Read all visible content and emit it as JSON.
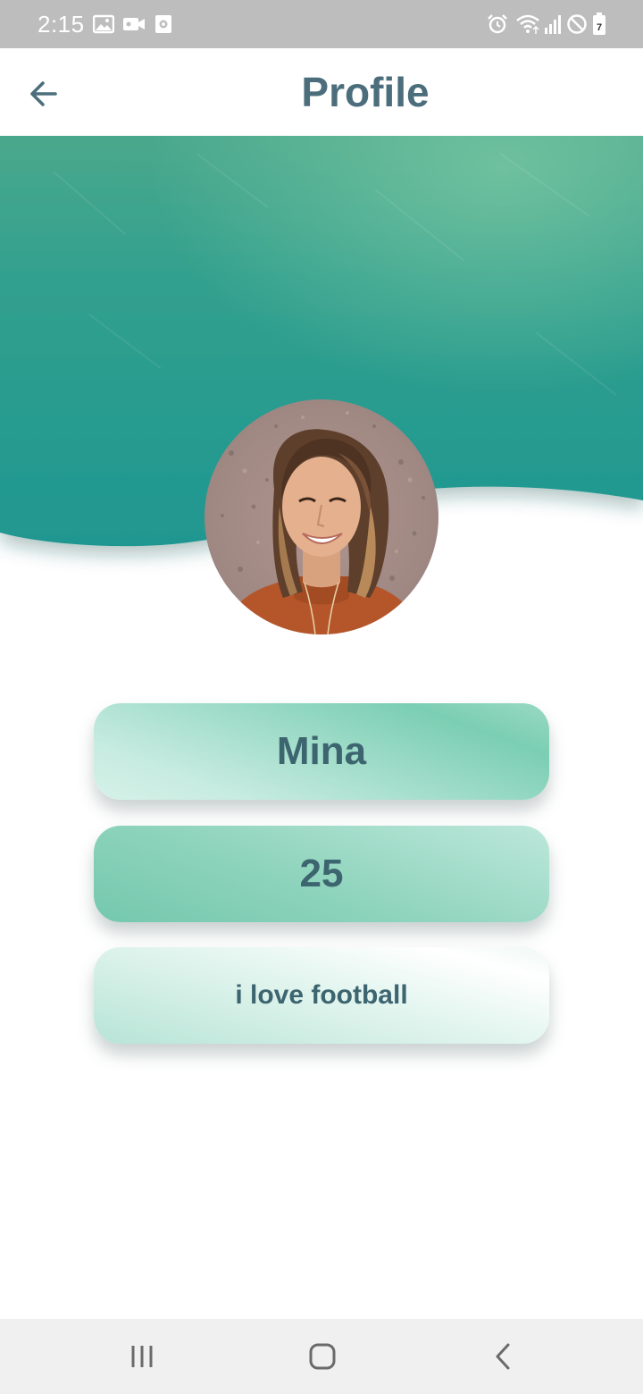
{
  "status_bar": {
    "time": "2:15",
    "left_icons": [
      "gallery-icon",
      "video-camera-icon",
      "screen-record-icon"
    ],
    "right_icons": [
      "alarm-icon",
      "wifi-icon",
      "signal-icon",
      "do-not-disturb-icon",
      "battery-icon"
    ],
    "battery_level": "7"
  },
  "app_bar": {
    "title": "Profile",
    "back_icon": "arrow-left-icon"
  },
  "profile": {
    "avatar": "profile-photo",
    "name": "Mina",
    "age": "25",
    "bio": "i love football"
  },
  "nav_bar": {
    "buttons": [
      "recent-apps-icon",
      "home-icon",
      "back-icon"
    ]
  },
  "colors": {
    "title": "#4c6e7c",
    "card_text": "#3d6570",
    "banner_top": "#4aa88c",
    "banner_bottom": "#1f9790",
    "status_bar": "#bdbdbd",
    "nav_bar": "#f0f0f0"
  }
}
